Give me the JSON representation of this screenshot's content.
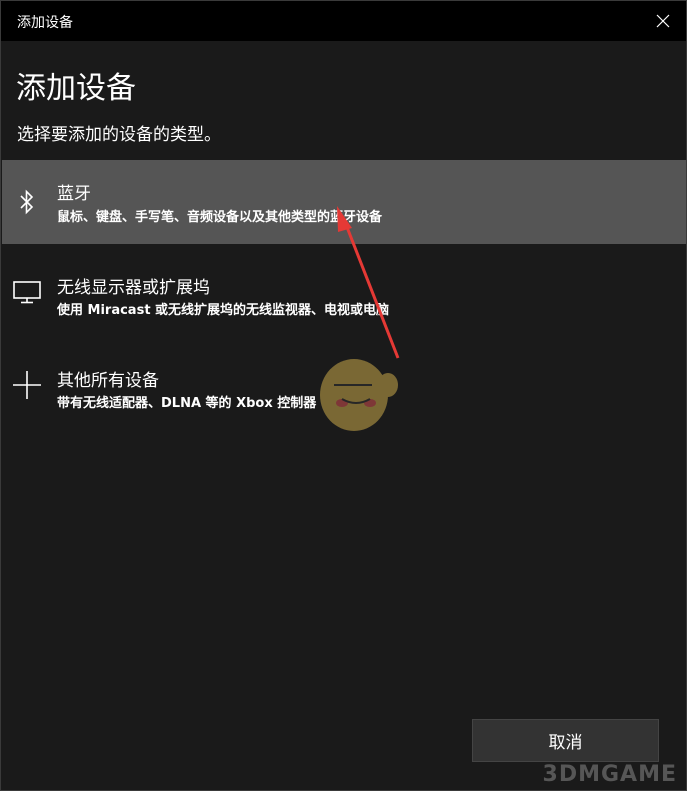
{
  "window": {
    "title": "添加设备"
  },
  "heading": "添加设备",
  "subtitle": "选择要添加的设备的类型。",
  "options": [
    {
      "title": "蓝牙",
      "description": "鼠标、键盘、手写笔、音频设备以及其他类型的蓝牙设备",
      "icon": "bluetooth-icon",
      "selected": true
    },
    {
      "title": "无线显示器或扩展坞",
      "description": "使用 Miracast 或无线扩展坞的无线监视器、电视或电脑",
      "icon": "monitor-icon",
      "selected": false
    },
    {
      "title": "其他所有设备",
      "description": "带有无线适配器、DLNA 等的 Xbox 控制器",
      "icon": "plus-icon",
      "selected": false
    }
  ],
  "cancel_label": "取消",
  "watermark": "3DMGAME",
  "colors": {
    "titlebar": "#000000",
    "background": "#1a1a1a",
    "selected_item": "#555555",
    "button": "#333333",
    "annotation_arrow": "#e53935"
  }
}
